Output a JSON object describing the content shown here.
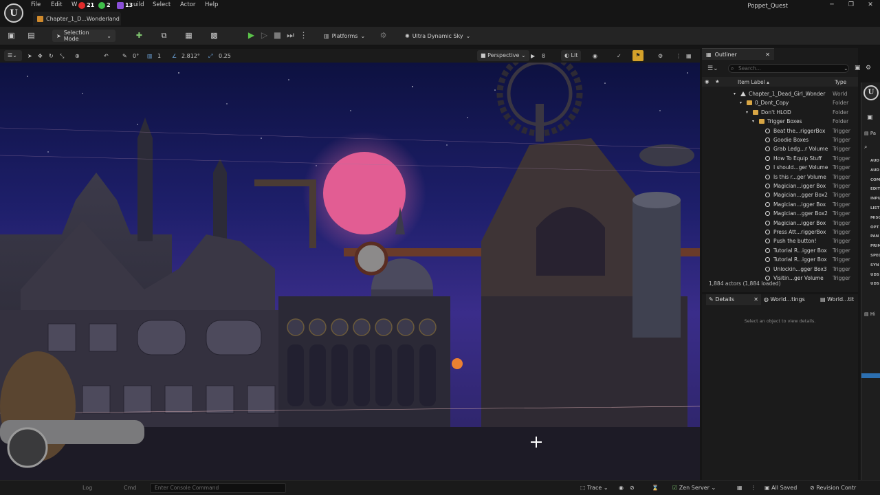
{
  "menu": {
    "items": [
      "File",
      "Edit",
      "Build",
      "Select",
      "Actor",
      "Help"
    ],
    "badges": [
      {
        "count": "21",
        "color": "#e02b2b",
        "icon": "youtube-icon"
      },
      {
        "count": "2",
        "color": "#3fbf4a",
        "icon": "chat-icon"
      },
      {
        "count": "13",
        "color": "#8a4fd8",
        "icon": "twitch-icon"
      }
    ],
    "project_name": "Poppet_Quest"
  },
  "level_tab": {
    "label": "Chapter_1_D...Wonderland"
  },
  "toolbar": {
    "mode_label": "Selection Mode",
    "platforms_label": "Platforms",
    "sky_label": "Ultra Dynamic Sky"
  },
  "viewport_toolbar": {
    "rotation_snap": "0°",
    "grid": "1",
    "scale": "2.812°",
    "speed": "0.25",
    "perspective_label": "Perspective",
    "camera_speed": "8",
    "lit_label": "Lit"
  },
  "outliner": {
    "title": "Outliner",
    "search_placeholder": "Search...",
    "col_label": "Item Label ▴",
    "col_type": "Type",
    "rows": [
      {
        "label": "Chapter_1_Dead_Girl_Wonder",
        "type": "World",
        "indent": 0,
        "icon": "world"
      },
      {
        "label": "0_Dont_Copy",
        "type": "Folder",
        "indent": 1,
        "icon": "folder"
      },
      {
        "label": "Don't HLOD",
        "type": "Folder",
        "indent": 2,
        "icon": "folder"
      },
      {
        "label": "Trigger Boxes",
        "type": "Folder",
        "indent": 3,
        "icon": "folder"
      },
      {
        "label": "Beat the...riggerBox",
        "type": "Trigger",
        "indent": 4,
        "icon": "trigger"
      },
      {
        "label": "Goodie Boxes",
        "type": "Trigger",
        "indent": 4,
        "icon": "trigger"
      },
      {
        "label": "Grab Ledg...r Volume",
        "type": "Trigger",
        "indent": 4,
        "icon": "trigger"
      },
      {
        "label": "How To Equip Stuff",
        "type": "Trigger",
        "indent": 4,
        "icon": "trigger"
      },
      {
        "label": "I should...ger Volume",
        "type": "Trigger",
        "indent": 4,
        "icon": "trigger"
      },
      {
        "label": "Is this r...ger Volume",
        "type": "Trigger",
        "indent": 4,
        "icon": "trigger"
      },
      {
        "label": "Magician...igger Box",
        "type": "Trigger",
        "indent": 4,
        "icon": "trigger"
      },
      {
        "label": "Magician...gger Box2",
        "type": "Trigger",
        "indent": 4,
        "icon": "trigger"
      },
      {
        "label": "Magician...igger Box",
        "type": "Trigger",
        "indent": 4,
        "icon": "trigger"
      },
      {
        "label": "Magician...gger Box2",
        "type": "Trigger",
        "indent": 4,
        "icon": "trigger"
      },
      {
        "label": "Magician...igger Box",
        "type": "Trigger",
        "indent": 4,
        "icon": "trigger"
      },
      {
        "label": "Press Att...riggerBox",
        "type": "Trigger",
        "indent": 4,
        "icon": "trigger"
      },
      {
        "label": "Push the button!",
        "type": "Trigger",
        "indent": 4,
        "icon": "trigger"
      },
      {
        "label": "Tutorial R...igger Box",
        "type": "Trigger",
        "indent": 4,
        "icon": "trigger"
      },
      {
        "label": "Tutorial R...igger Box",
        "type": "Trigger",
        "indent": 4,
        "icon": "trigger"
      },
      {
        "label": "Unlockin...gger Box3",
        "type": "Trigger",
        "indent": 4,
        "icon": "trigger"
      },
      {
        "label": "Visitin...ger Volume",
        "type": "Trigger",
        "indent": 4,
        "icon": "trigger"
      }
    ],
    "actor_count": "1,884 actors (1,884 loaded)"
  },
  "details": {
    "tabs": [
      "Details",
      "World...tings",
      "World...tit"
    ],
    "empty_message": "Select an object to view details."
  },
  "right_column": {
    "items": [
      "AUD",
      "AUD",
      "COM",
      "EDIT",
      "INPU",
      "LIST",
      "MISC",
      "OPT",
      "PAN",
      "PRIM",
      "SPEC",
      "SYN",
      "UDS",
      "UDS"
    ]
  },
  "statusbar": {
    "console_placeholder": "Enter Console Command",
    "trace_label": "Trace",
    "zen_label": "Zen Server",
    "saved_label": "All Saved",
    "revision_label": "Revision Contr"
  }
}
